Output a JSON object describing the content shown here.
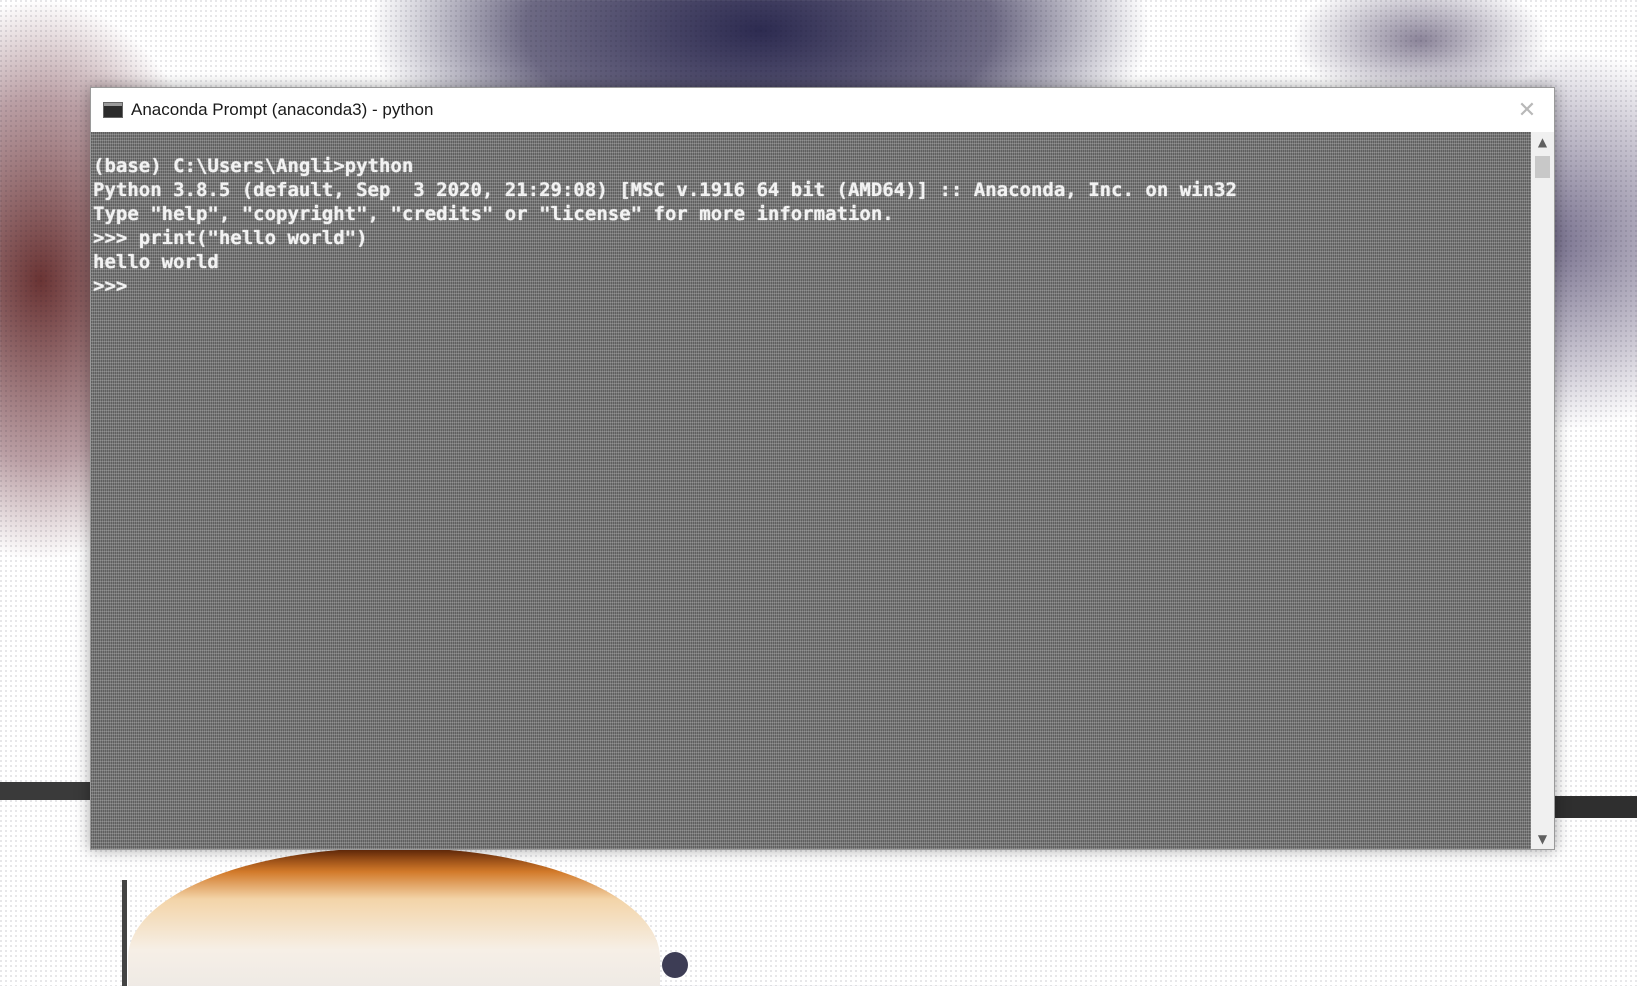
{
  "window": {
    "title": "Anaconda Prompt (anaconda3) - python",
    "close_symbol": "✕"
  },
  "console": {
    "lines": [
      "(base) C:\\Users\\Angli>python",
      "Python 3.8.5 (default, Sep  3 2020, 21:29:08) [MSC v.1916 64 bit (AMD64)] :: Anaconda, Inc. on win32",
      "Type \"help\", \"copyright\", \"credits\" or \"license\" for more information.",
      ">>> print(\"hello world\")",
      "hello world",
      ">>>"
    ]
  },
  "scrollbar": {
    "up_symbol": "▲",
    "down_symbol": "▼",
    "position": 0
  },
  "icons": {
    "app": "console-icon",
    "close": "close-icon",
    "scroll_up": "scroll-up-arrow-icon",
    "scroll_down": "scroll-down-arrow-icon"
  }
}
